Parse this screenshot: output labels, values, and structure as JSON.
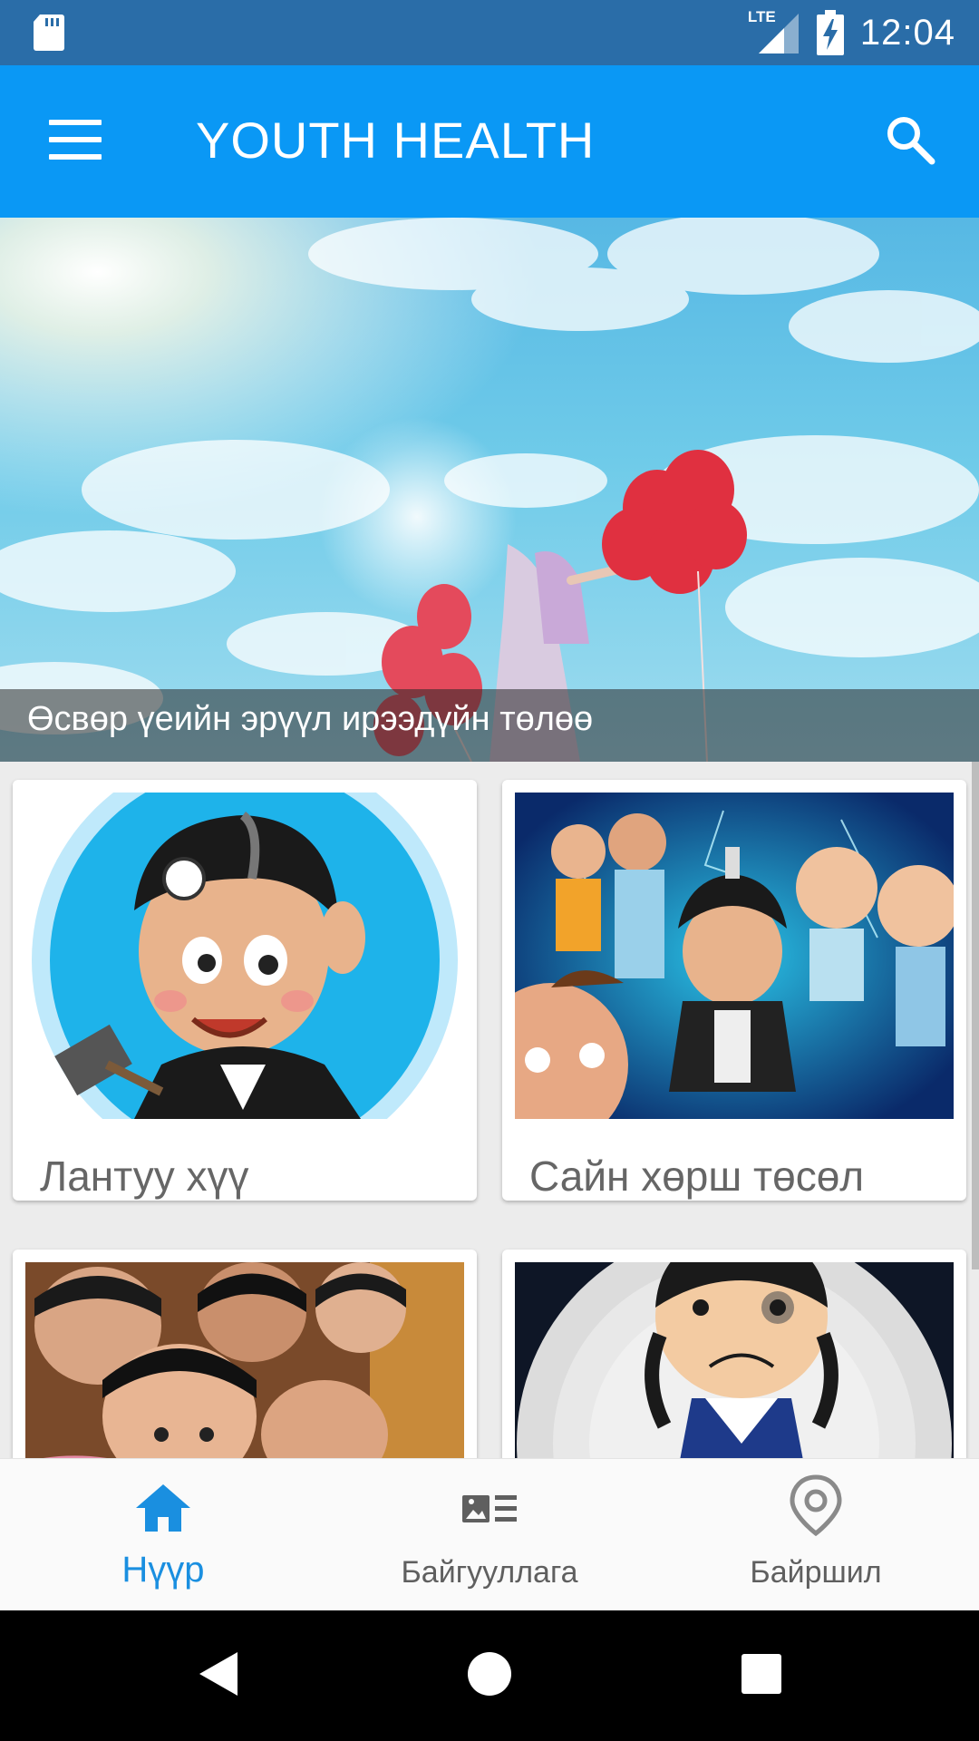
{
  "status_bar": {
    "network": "LTE",
    "time": "12:04",
    "icons": [
      "sd-card-icon",
      "signal-icon",
      "battery-charging-icon"
    ]
  },
  "app_bar": {
    "title": "YOUTH HEALTH",
    "menu_icon": "hamburger-menu-icon",
    "search_icon": "search-icon"
  },
  "hero": {
    "caption": "Өсвөр үеийн эрүүл ирээдүйн төлөө"
  },
  "cards": [
    {
      "title": "Лантуу хүү",
      "image": "lantuu-boy-cartoon"
    },
    {
      "title": "Сайн хөрш төсөл",
      "image": "good-neighbor-cartoon-group"
    },
    {
      "title": "",
      "image": "children-drawing-photo"
    },
    {
      "title": "",
      "image": "sad-girl-cartoon"
    }
  ],
  "bottom_nav": {
    "items": [
      {
        "label": "Нүүр",
        "icon": "home-icon",
        "active": true
      },
      {
        "label": "Байгууллага",
        "icon": "organization-list-icon",
        "active": false
      },
      {
        "label": "Байршил",
        "icon": "location-pin-icon",
        "active": false
      }
    ]
  },
  "colors": {
    "status_bar": "#2a6da8",
    "app_bar": "#0a98f5",
    "accent": "#1a8fe0"
  }
}
